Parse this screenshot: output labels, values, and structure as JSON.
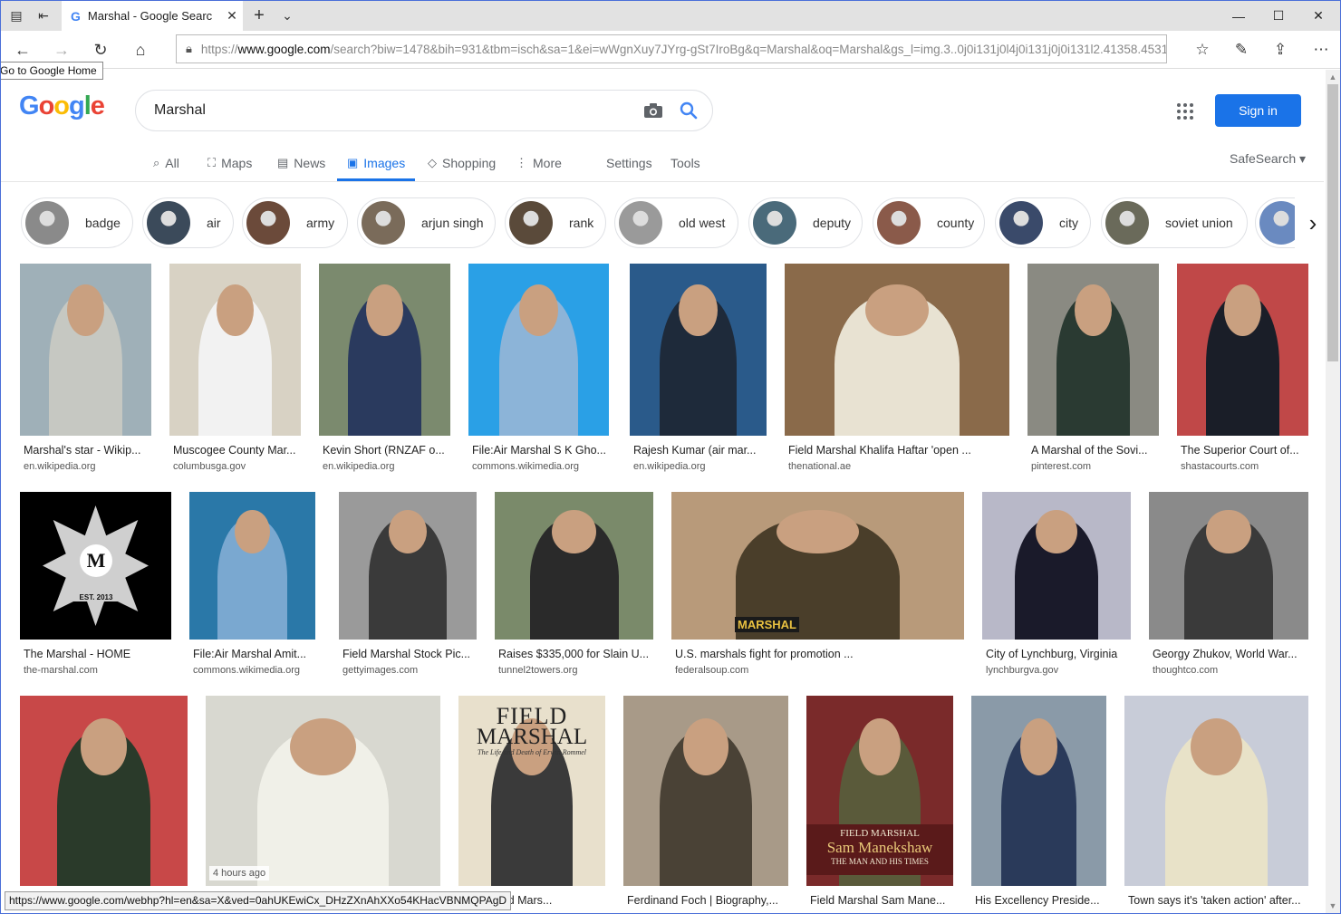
{
  "browser": {
    "tab_title": "Marshal - Google Searc",
    "url_prefix": "https://",
    "url_domain": "www.google.com",
    "url_rest": "/search?biw=1478&bih=931&tbm=isch&sa=1&ei=wWgnXuy7JYrg-gSt7IroBg&q=Marshal&oq=Marshal&gs_l=img.3..0j0i131j0l4j0i131j0j0i131l2.41358.45315...",
    "tooltip": "Go to Google Home",
    "status_url": "https://www.google.com/webhp?hl=en&sa=X&ved=0ahUKEwiCx_DHzZXnAhXXo54KHacVBNMQPAgD"
  },
  "google": {
    "logo": [
      "G",
      "o",
      "o",
      "g",
      "l",
      "e"
    ],
    "logo_colors": [
      "#4285f4",
      "#ea4335",
      "#fbbc05",
      "#4285f4",
      "#34a853",
      "#ea4335"
    ],
    "query": "Marshal",
    "sign_in": "Sign in",
    "safesearch": "SafeSearch",
    "tabs": [
      {
        "label": "All",
        "icon": "search-icon"
      },
      {
        "label": "Maps",
        "icon": "map-icon"
      },
      {
        "label": "News",
        "icon": "newspaper-icon"
      },
      {
        "label": "Images",
        "icon": "image-icon",
        "active": true
      },
      {
        "label": "Shopping",
        "icon": "tag-icon"
      },
      {
        "label": "More",
        "icon": "more-vert-icon"
      },
      {
        "label": "Settings"
      },
      {
        "label": "Tools"
      }
    ]
  },
  "chips": [
    {
      "label": "badge",
      "color": "#8a8a8a"
    },
    {
      "label": "air",
      "color": "#3b4a5a"
    },
    {
      "label": "army",
      "color": "#6b4a3a"
    },
    {
      "label": "arjun singh",
      "color": "#7a6b5a"
    },
    {
      "label": "rank",
      "color": "#5a4a3a"
    },
    {
      "label": "old west",
      "color": "#9a9a9a"
    },
    {
      "label": "deputy",
      "color": "#4a6a7a"
    },
    {
      "label": "county",
      "color": "#8a5a4a"
    },
    {
      "label": "city",
      "color": "#3a4a6a"
    },
    {
      "label": "soviet union",
      "color": "#6a6a5a"
    },
    {
      "label": "",
      "color": "#6a8ac0"
    }
  ],
  "results": [
    [
      {
        "caption": "Marshal's star - Wikip...",
        "source": "en.wikipedia.org",
        "bg": "#9fb0b8",
        "fg": "#c6c8c2"
      },
      {
        "caption": "Muscogee County Mar...",
        "source": "columbusga.gov",
        "bg": "#d8d2c4",
        "fg": "#f2f2f2"
      },
      {
        "caption": "Kevin Short (RNZAF o...",
        "source": "en.wikipedia.org",
        "bg": "#7b8a6e",
        "fg": "#2a3a5e"
      },
      {
        "caption": "File:Air Marshal S K Gho...",
        "source": "commons.wikimedia.org",
        "bg": "#2aa0e6",
        "fg": "#8cb4d8"
      },
      {
        "caption": "Rajesh Kumar (air mar...",
        "source": "en.wikipedia.org",
        "bg": "#2a5a8a",
        "fg": "#1e2a3a"
      },
      {
        "caption": "Field Marshal Khalifa Haftar 'open ...",
        "source": "thenational.ae",
        "bg": "#8a6a4a",
        "fg": "#e8e2d2"
      },
      {
        "caption": "A Marshal of the Sovi...",
        "source": "pinterest.com",
        "bg": "#8a8a82",
        "fg": "#2a3a32"
      },
      {
        "caption": "The Superior Court of...",
        "source": "shastacourts.com",
        "bg": "#c04848",
        "fg": "#1a1e28"
      }
    ],
    [
      {
        "caption": "The Marshal - HOME",
        "source": "the-marshal.com",
        "bg": "#000000",
        "fg": "#d0d0d0"
      },
      {
        "caption": "File:Air Marshal Amit...",
        "source": "commons.wikimedia.org",
        "bg": "#2a78a8",
        "fg": "#7aa8d0"
      },
      {
        "caption": "Field Marshal Stock Pic...",
        "source": "gettyimages.com",
        "bg": "#9a9a9a",
        "fg": "#3a3a3a"
      },
      {
        "caption": "Raises $335,000 for Slain U...",
        "source": "tunnel2towers.org",
        "bg": "#7a8a6a",
        "fg": "#2a2a2a"
      },
      {
        "caption": "U.S. marshals fight for promotion ...",
        "source": "federalsoup.com",
        "bg": "#b89a7a",
        "fg": "#4a3e2a"
      },
      {
        "caption": "City of Lynchburg, Virginia",
        "source": "lynchburgva.gov",
        "bg": "#b8b8c8",
        "fg": "#1a1a2a"
      },
      {
        "caption": "Georgy Zhukov, World War...",
        "source": "thoughtco.com",
        "bg": "#8a8a8a",
        "fg": "#3a3a3a"
      }
    ],
    [
      {
        "caption": "",
        "source": "",
        "bg": "#c84848",
        "fg": "#2a3a2a"
      },
      {
        "caption": "",
        "source": "",
        "bg": "#d8d8d0",
        "fg": "#f0f0e8",
        "badge": "4 hours ago"
      },
      {
        "caption": "com: Field Mars...",
        "source": "",
        "bg": "#e8e0cc",
        "fg": "#3a3a3a"
      },
      {
        "caption": "Ferdinand Foch | Biography,...",
        "source": "",
        "bg": "#a89a88",
        "fg": "#4a4236"
      },
      {
        "caption": "Field Marshal Sam Mane...",
        "source": "",
        "bg": "#7a2a2a",
        "fg": "#5a5a3a"
      },
      {
        "caption": "His Excellency Preside...",
        "source": "",
        "bg": "#8a9aa8",
        "fg": "#2a3a5a"
      },
      {
        "caption": "Town says it's 'taken action' after...",
        "source": "",
        "bg": "#c8ccd8",
        "fg": "#e8e2c8"
      }
    ]
  ],
  "book_cover": {
    "line1": "FIELD",
    "line2": "MARSHAL",
    "line3": "The Life and Death of Erwin Rommel"
  },
  "sam_cover": {
    "line1": "FIELD MARSHAL",
    "line2": "Sam Manekshaw",
    "line3": "THE MAN AND HIS TIMES"
  },
  "marshal_logo": {
    "line1": "M",
    "line2": "EST. 2013"
  },
  "vest_text": "MARSHAL"
}
